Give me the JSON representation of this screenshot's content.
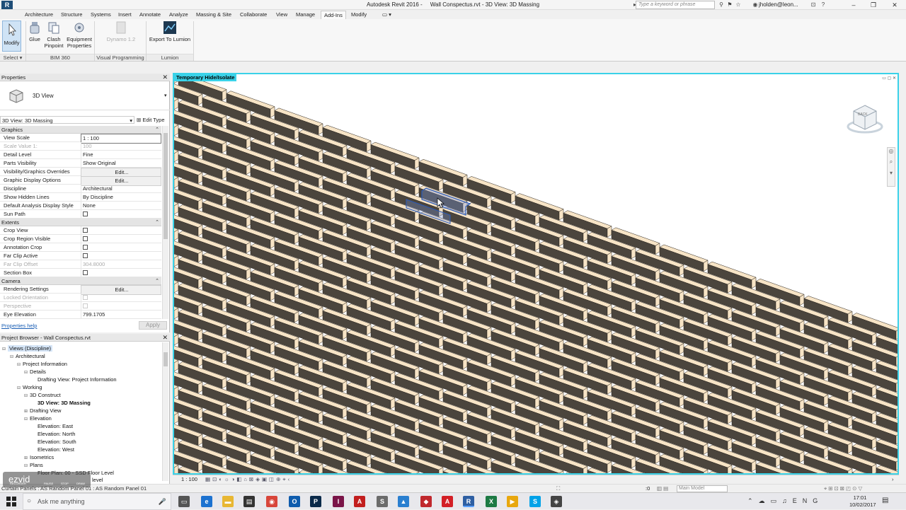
{
  "titlebar": {
    "app_title": "Autodesk Revit 2016 -",
    "file_title": "Wall Conspectus.rvt - 3D View: 3D Massing",
    "search_placeholder": "Type a keyword or phrase",
    "user": "jholden@leon..."
  },
  "tabs": [
    "Architecture",
    "Structure",
    "Systems",
    "Insert",
    "Annotate",
    "Analyze",
    "Massing & Site",
    "Collaborate",
    "View",
    "Manage",
    "Add-Ins",
    "Modify"
  ],
  "active_tab": "Add-Ins",
  "ribbon": {
    "modify": "Modify",
    "select": "Select",
    "glue": "Glue",
    "clash_line1": "Clash",
    "clash_line2": "Pinpoint",
    "equip_line1": "Equipment",
    "equip_line2": "Properties",
    "bim360": "BIM 360",
    "dynamo": "Dynamo 1.2",
    "visual_programming": "Visual Programming",
    "export_lumion": "Export To Lumion",
    "lumion": "Lumion"
  },
  "properties": {
    "title": "Properties",
    "type_name": "3D View",
    "instance": "3D View: 3D Massing",
    "edit_type": "Edit Type",
    "groups": {
      "graphics": "Graphics",
      "extents": "Extents",
      "camera": "Camera"
    },
    "rows": {
      "view_scale": {
        "k": "View Scale",
        "v": "1 : 100"
      },
      "scale_value": {
        "k": "Scale Value    1:",
        "v": "100"
      },
      "detail_level": {
        "k": "Detail Level",
        "v": "Fine"
      },
      "parts_visibility": {
        "k": "Parts Visibility",
        "v": "Show Original"
      },
      "vg_overrides": {
        "k": "Visibility/Graphics Overrides",
        "v": "Edit..."
      },
      "graphic_display": {
        "k": "Graphic Display Options",
        "v": "Edit..."
      },
      "discipline": {
        "k": "Discipline",
        "v": "Architectural"
      },
      "hidden_lines": {
        "k": "Show Hidden Lines",
        "v": "By Discipline"
      },
      "analysis_style": {
        "k": "Default Analysis Display Style",
        "v": "None"
      },
      "sun_path": {
        "k": "Sun Path",
        "v": ""
      },
      "crop_view": {
        "k": "Crop View",
        "v": ""
      },
      "crop_region": {
        "k": "Crop Region Visible",
        "v": ""
      },
      "annotation_crop": {
        "k": "Annotation Crop",
        "v": ""
      },
      "far_clip_active": {
        "k": "Far Clip Active",
        "v": ""
      },
      "far_clip_offset": {
        "k": "Far Clip Offset",
        "v": "304.8000"
      },
      "section_box": {
        "k": "Section Box",
        "v": ""
      },
      "rendering": {
        "k": "Rendering Settings",
        "v": "Edit..."
      },
      "locked_orientation": {
        "k": "Locked Orientation",
        "v": ""
      },
      "perspective": {
        "k": "Perspective",
        "v": ""
      },
      "eye_elevation": {
        "k": "Eye Elevation",
        "v": "799.1705"
      }
    },
    "help": "Properties help",
    "apply": "Apply"
  },
  "browser": {
    "title": "Project Browser - Wall Conspectus.rvt",
    "items": [
      "Views (Discipline)",
      "Architectural",
      "Project Information",
      "Details",
      "Drafting View: Project Information",
      "Working",
      "3D Construct",
      "3D View: 3D Massing",
      "Drafting View",
      "Elevation",
      "Elevation: East",
      "Elevation: North",
      "Elevation: South",
      "Elevation: West",
      "Isometrics",
      "Plans",
      "Floor Plan: 00 - SSD Floor Level",
      "level"
    ]
  },
  "viewport": {
    "temp_label": "Temporary Hide/Isolate",
    "viewcube_label": "BACK"
  },
  "viewbar": {
    "scale": "1 : 100"
  },
  "statusbar": {
    "text": "Curtain Panels : AS Random Panel 01 : AS Random Panel 01",
    "zero": ":0",
    "main_model": "Main Model"
  },
  "taskbar": {
    "search": "Ask me anything",
    "time": "17:01",
    "date": "10/02/2017"
  },
  "watermark": {
    "brand": "ezvid",
    "sub": "RECORDER",
    "pause": "PAUSE",
    "stop": "STOP",
    "draw": "DRAW"
  },
  "colors": {
    "accent": "#3ad2e8",
    "brick_face": "#f7e4c6",
    "brick_dark": "#4b453d",
    "selection": "#2a5ab8"
  }
}
